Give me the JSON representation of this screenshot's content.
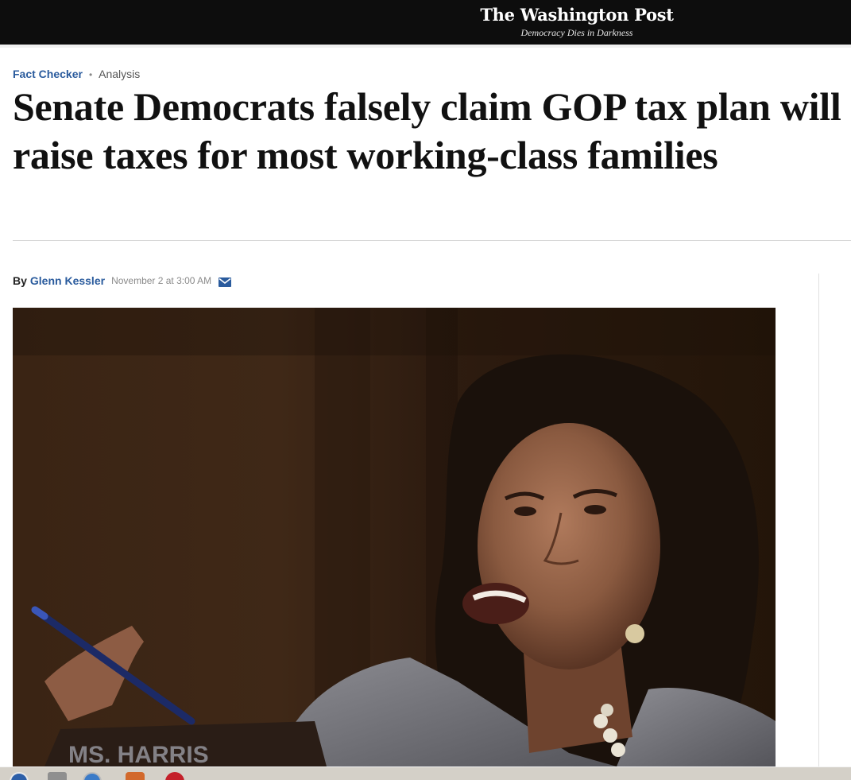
{
  "header": {
    "logo": "The Washington Post",
    "tagline": "Democracy Dies in Darkness"
  },
  "article": {
    "section": "Fact Checker",
    "label": "Analysis",
    "headline": "Senate Democrats falsely claim GOP tax plan will raise taxes for most working-class families",
    "byline_prefix": "By",
    "author": "Glenn Kessler",
    "date": "November 2 at 3:00 AM"
  },
  "photo": {
    "nameplate": "MS. HARRIS"
  },
  "icons": {
    "mail": "envelope-icon"
  },
  "colors": {
    "topbar": "#0d0d0d",
    "link": "#2a5b9d",
    "headline": "#111111"
  }
}
